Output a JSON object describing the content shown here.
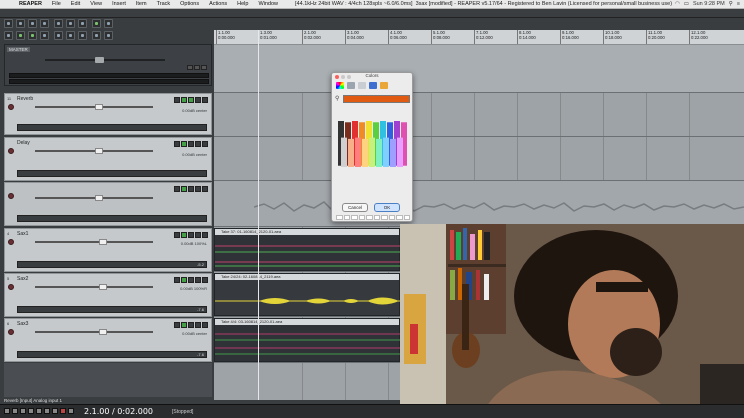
{
  "menubar": {
    "app_name": "REAPER",
    "items": [
      "File",
      "Edit",
      "View",
      "Insert",
      "Item",
      "Track",
      "Options",
      "Actions",
      "Help",
      "Window"
    ],
    "window_title": "[44.1kHz 24bit WAV : 4/4ch 128spls ~6.0/6.0ms]",
    "title_suffix": "3sax [modified] - REAPER v5.17/64 - Registered to Ben Lavin (Licensed for personal/small business use)",
    "clock": "Sun 9:28 PM"
  },
  "master": {
    "label": "MASTER"
  },
  "tracks": [
    {
      "num": "11",
      "name": "Reverb",
      "vol": "0.00dB center"
    },
    {
      "num": "",
      "name": "Delay",
      "vol": "0.00dB center"
    },
    {
      "num": "",
      "name": "",
      "vol": ""
    },
    {
      "num": "4",
      "name": "Sax1",
      "vol": "0.00dB 100%L",
      "meter": "-5.2"
    },
    {
      "num": "5",
      "name": "Sax2",
      "vol": "0.00dB 100%R",
      "meter": "-7.6"
    },
    {
      "num": "6",
      "name": "Sax3",
      "vol": "0.00dB center",
      "meter": "-7.6"
    }
  ],
  "ruler": {
    "ticks": [
      {
        "bar": "1.1.00",
        "time": "0:00.000"
      },
      {
        "bar": "1.3.00",
        "time": "0:01.000"
      },
      {
        "bar": "2.1.00",
        "time": "0:02.000"
      },
      {
        "bar": "3.1.00",
        "time": "0:04.000"
      },
      {
        "bar": "4.1.00",
        "time": "0:06.000"
      },
      {
        "bar": "5.1.00",
        "time": "0:08.000"
      },
      {
        "bar": "6.1.00",
        "time": "0:10.000"
      },
      {
        "bar": "7.1.00",
        "time": "0:12.000"
      },
      {
        "bar": "8.1.00",
        "time": "0:14.000"
      },
      {
        "bar": "9.1.00",
        "time": "0:16.000"
      },
      {
        "bar": "10.1.00",
        "time": "0:18.000"
      },
      {
        "bar": "11.1.00",
        "time": "0:20.000"
      },
      {
        "bar": "12.1.00",
        "time": "0:22.000"
      }
    ]
  },
  "items": [
    {
      "label": "Take 37: 01-160814_2120-01.aea"
    },
    {
      "label": "Take 24/24: 02-160814_2119.aea"
    },
    {
      "label": "Take 4/4: 03-160814_2120-01.aea"
    }
  ],
  "color_picker": {
    "title": "Colors",
    "cancel_label": "Cancel",
    "ok_label": "OK",
    "selected_color": "#e05a12"
  },
  "transport": {
    "status": "Reverb [Input] Analog input 1",
    "timecode": "2.1.00 / 0:02.000",
    "state": "[Stopped]"
  }
}
